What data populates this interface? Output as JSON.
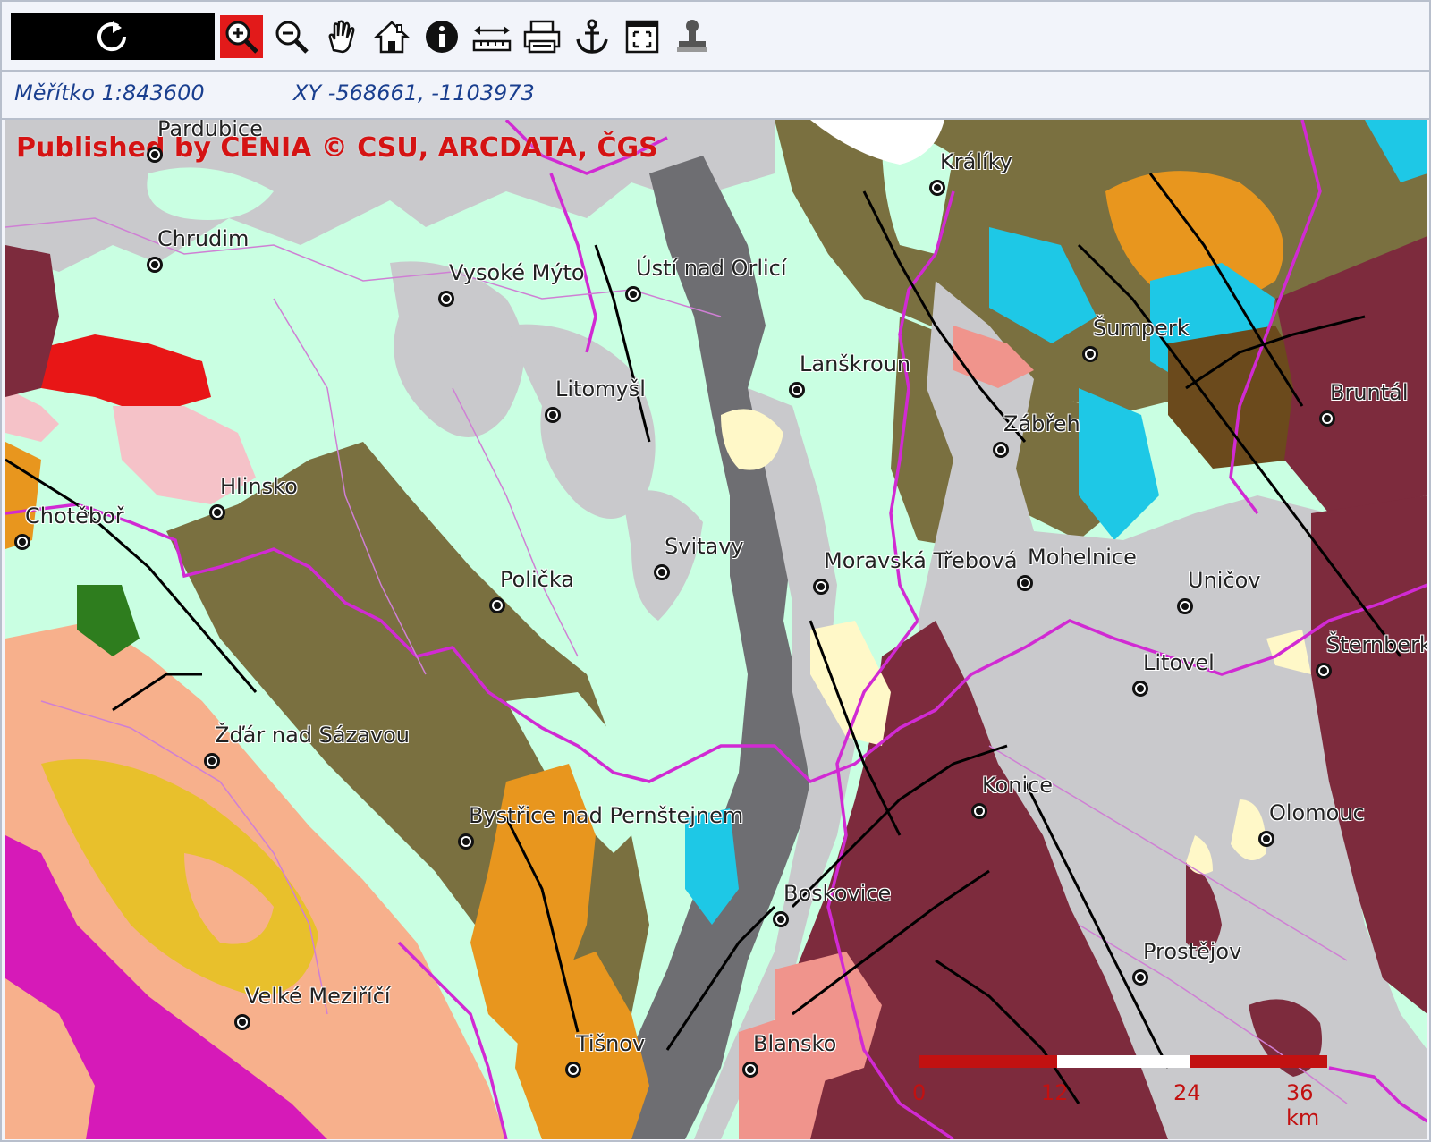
{
  "toolbar": {
    "refresh_icon": "refresh-icon",
    "tools": [
      {
        "name": "zoom-in-tool",
        "icon": "zoom-in-icon",
        "active": true
      },
      {
        "name": "zoom-out-tool",
        "icon": "zoom-out-icon",
        "active": false
      },
      {
        "name": "pan-tool",
        "icon": "hand-icon",
        "active": false
      },
      {
        "name": "home-tool",
        "icon": "home-icon",
        "active": false
      },
      {
        "name": "info-tool",
        "icon": "info-icon",
        "active": false
      },
      {
        "name": "measure-tool",
        "icon": "measure-icon",
        "active": false
      },
      {
        "name": "print-tool",
        "icon": "printer-icon",
        "active": false
      },
      {
        "name": "anchor-tool",
        "icon": "anchor-icon",
        "active": false
      },
      {
        "name": "extent-tool",
        "icon": "full-extent-icon",
        "active": false
      },
      {
        "name": "stamp-tool",
        "icon": "stamp-icon",
        "active": false
      }
    ]
  },
  "status": {
    "scale": "Měřítko 1:843600",
    "coords": "XY -568661, -1103973"
  },
  "map": {
    "credit": "Published by CENIA  © CSU, ARCDATA, ČGS",
    "cities": [
      {
        "name": "Pardubice"
      },
      {
        "name": "Chrudim"
      },
      {
        "name": "Vysoké Mýto"
      },
      {
        "name": "Ústí nad Orlicí"
      },
      {
        "name": "Králíky"
      },
      {
        "name": "Šumperk"
      },
      {
        "name": "Lanškroun"
      },
      {
        "name": "Litomyšl"
      },
      {
        "name": "Zábřeh"
      },
      {
        "name": "Bruntál"
      },
      {
        "name": "Hlinsko"
      },
      {
        "name": "Chotěboř"
      },
      {
        "name": "Svitavy"
      },
      {
        "name": "Polička"
      },
      {
        "name": "Moravská Třebová"
      },
      {
        "name": "Mohelnice"
      },
      {
        "name": "Uničov"
      },
      {
        "name": "Šternberk"
      },
      {
        "name": "Litovel"
      },
      {
        "name": "Žďár nad Sázavou"
      },
      {
        "name": "Konice"
      },
      {
        "name": "Olomouc"
      },
      {
        "name": "Bystřice nad Pernštejnem"
      },
      {
        "name": "Boskovice"
      },
      {
        "name": "Prostějov"
      },
      {
        "name": "Velké Meziříčí"
      },
      {
        "name": "Tišnov"
      },
      {
        "name": "Blansko"
      }
    ],
    "scale_bar": {
      "ticks": [
        "0",
        "12",
        "24",
        "36 km"
      ],
      "colors": [
        "#c21111",
        "#ffffff",
        "#c21111"
      ]
    }
  },
  "colors": {
    "background_lowland": "#c9ffe2",
    "quaternary_grey": "#c9c9cc",
    "olive": "#7a7040",
    "maroon": "#7d2b3d",
    "salmon": "#f7b08c",
    "orange": "#e8961e",
    "magenta": "#d61ab8",
    "cyan": "#1ec8e6",
    "dark_grey": "#6e6e72",
    "boundary": "#d12ad3",
    "fault": "#000000"
  }
}
